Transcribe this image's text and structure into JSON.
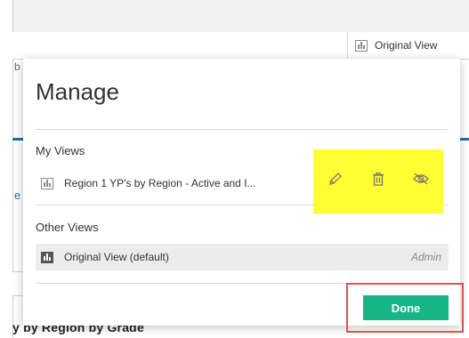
{
  "page": {
    "original_view_label": "Original View",
    "bottom_text": "y by Region by Grade",
    "fragment_b": "b",
    "fragment_e": "e"
  },
  "modal": {
    "title": "Manage",
    "my_views_label": "My Views",
    "my_views": [
      {
        "name": "Region 1 YP's by Region - Active and I..."
      }
    ],
    "other_views_label": "Other Views",
    "other_views": [
      {
        "name": "Original View (default)",
        "owner": "Admin"
      }
    ],
    "done_label": "Done"
  },
  "colors": {
    "done": "#17b584",
    "highlight": "#ffff33",
    "annotation_box": "#d9534f",
    "accent_blue": "#1f6fb2"
  },
  "icons": {
    "edit": "pencil-icon",
    "delete": "trash-icon",
    "hide": "eye-slash-icon",
    "view": "bar-chart-icon"
  }
}
